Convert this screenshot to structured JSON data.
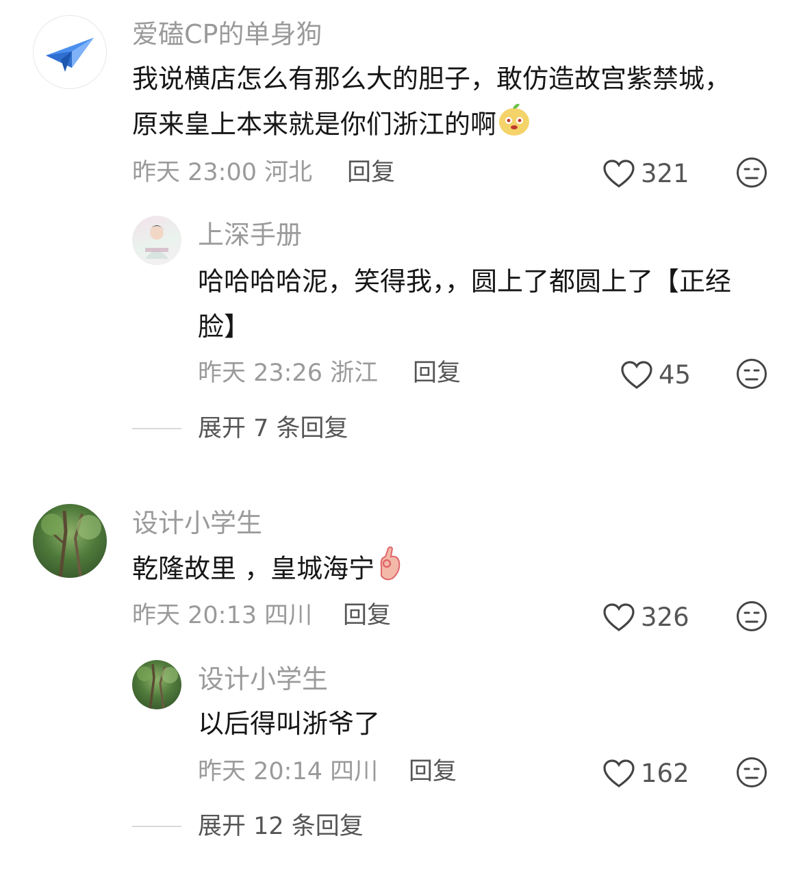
{
  "comments": [
    {
      "user": "爱磕CP的单身狗",
      "avatar_icon": "paper-plane-icon",
      "text": "我说横店怎么有那么大的胆子，敢仿造故宫紫禁城，原来皇上本来就是你们浙江的啊",
      "emoji": "mango-face-emoji",
      "time": "昨天 23:00",
      "location": "河北",
      "reply_label": "回复",
      "likes": "321",
      "replies": [
        {
          "user": "上深手册",
          "avatar_icon": "costume-portrait-avatar",
          "text": "哈哈哈哈泥，笑得我，，圆上了都圆上了【正经脸】",
          "time": "昨天 23:26",
          "location": "浙江",
          "reply_label": "回复",
          "likes": "45"
        }
      ],
      "expand_label": "展开 7 条回复"
    },
    {
      "user": "设计小学生",
      "avatar_icon": "forest-photo-avatar",
      "text": "乾隆故里 ，皇城海宁",
      "emoji": "ok-hand-emoji",
      "time": "昨天 20:13",
      "location": "四川",
      "reply_label": "回复",
      "likes": "326",
      "replies": [
        {
          "user": "设计小学生",
          "avatar_icon": "forest-photo-avatar",
          "text": "以后得叫浙爷了",
          "time": "昨天 20:14",
          "location": "四川",
          "reply_label": "回复",
          "likes": "162"
        }
      ],
      "expand_label": "展开 12 条回复"
    }
  ],
  "colors": {
    "accent_blue": "#4a8ff0",
    "muted_text": "#9a9a9a"
  }
}
